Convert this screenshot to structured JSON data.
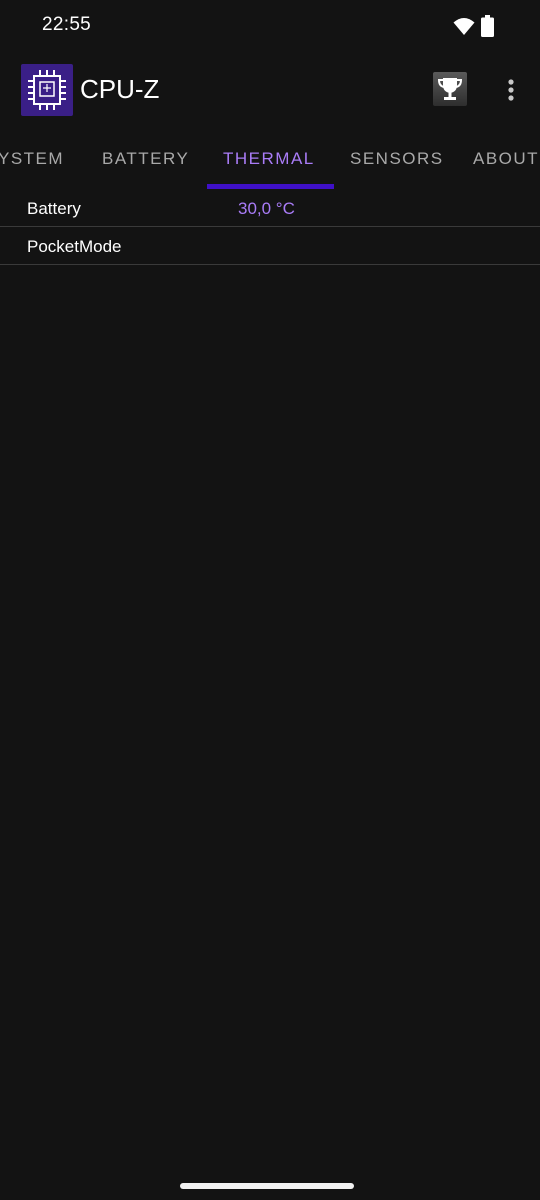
{
  "status_bar": {
    "time": "22:55",
    "icons": [
      "wifi-icon",
      "battery-icon"
    ]
  },
  "app_bar": {
    "title": "CPU-Z",
    "logo_icon": "cpu-chip-icon",
    "actions": [
      "trophy-icon",
      "more-vert-icon"
    ]
  },
  "tabs": [
    {
      "label": "SYSTEM",
      "visible_text": "YSTEM",
      "active": false
    },
    {
      "label": "BATTERY",
      "active": false
    },
    {
      "label": "THERMAL",
      "active": true
    },
    {
      "label": "SENSORS",
      "active": false
    },
    {
      "label": "ABOUT",
      "active": false
    }
  ],
  "thermal": {
    "rows": [
      {
        "label": "Battery",
        "value": "30,0 °C"
      },
      {
        "label": "PocketMode",
        "value": ""
      }
    ]
  },
  "colors": {
    "background": "#131313",
    "accent_text": "#a97cf7",
    "tab_indicator": "#3f10c8",
    "logo_bg": "#3a1f87",
    "inactive_tab": "#a9a9a9",
    "divider": "#3a3a3a"
  }
}
